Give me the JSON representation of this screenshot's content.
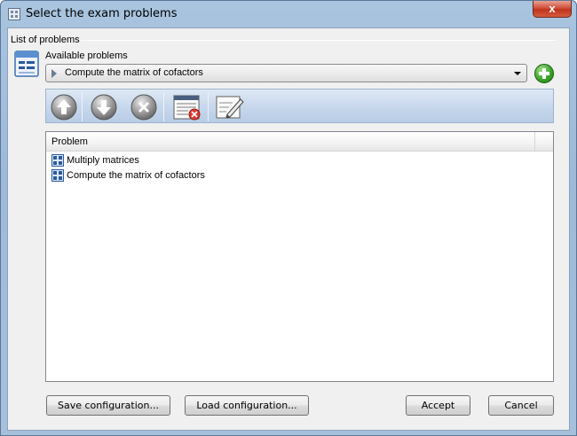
{
  "window": {
    "title": "Select the exam problems",
    "close_label": "x"
  },
  "group": {
    "label": "List of problems"
  },
  "available": {
    "label": "Available problems",
    "selected": "Compute the matrix of cofactors"
  },
  "toolbar": {
    "icons": [
      "up-arrow-icon",
      "down-arrow-icon",
      "delete-circle-icon",
      "remove-list-icon",
      "edit-icon"
    ]
  },
  "table": {
    "header": "Problem",
    "rows": [
      {
        "label": "Multiply matrices",
        "icon": "matrix-icon"
      },
      {
        "label": "Compute the matrix of cofactors",
        "icon": "matrix-icon"
      }
    ]
  },
  "buttons": {
    "save": "Save configuration...",
    "load": "Load configuration...",
    "accept": "Accept",
    "cancel": "Cancel"
  }
}
